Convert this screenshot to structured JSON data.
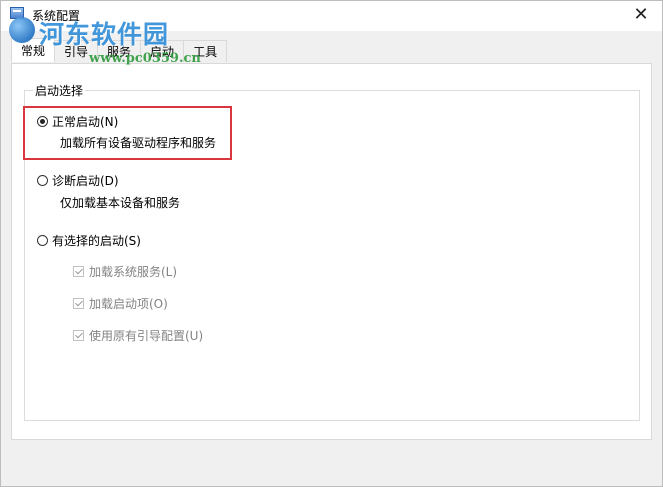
{
  "window": {
    "title": "系统配置",
    "close_glyph": "✕"
  },
  "watermark": {
    "title": "河东软件园",
    "url": "www.pc0359.cn"
  },
  "tabs": [
    {
      "label": "常规",
      "active": true
    },
    {
      "label": "引导",
      "active": false
    },
    {
      "label": "服务",
      "active": false
    },
    {
      "label": "启动",
      "active": false
    },
    {
      "label": "工具",
      "active": false
    }
  ],
  "startup": {
    "group_label": "启动选择",
    "options": [
      {
        "label": "正常启动(N)",
        "desc": "加载所有设备驱动程序和服务",
        "selected": true
      },
      {
        "label": "诊断启动(D)",
        "desc": "仅加载基本设备和服务",
        "selected": false
      },
      {
        "label": "有选择的启动(S)",
        "selected": false
      }
    ],
    "selective_items": [
      {
        "label": "加载系统服务(L)",
        "checked": true,
        "enabled": false
      },
      {
        "label": "加载启动项(O)",
        "checked": true,
        "enabled": false
      },
      {
        "label": "使用原有引导配置(U)",
        "checked": true,
        "enabled": false
      }
    ]
  },
  "colors": {
    "highlight_border": "#d9363e",
    "disabled_text": "#838383",
    "watermark_blue": "#2a8ad8",
    "watermark_green": "#2e9a3b"
  }
}
